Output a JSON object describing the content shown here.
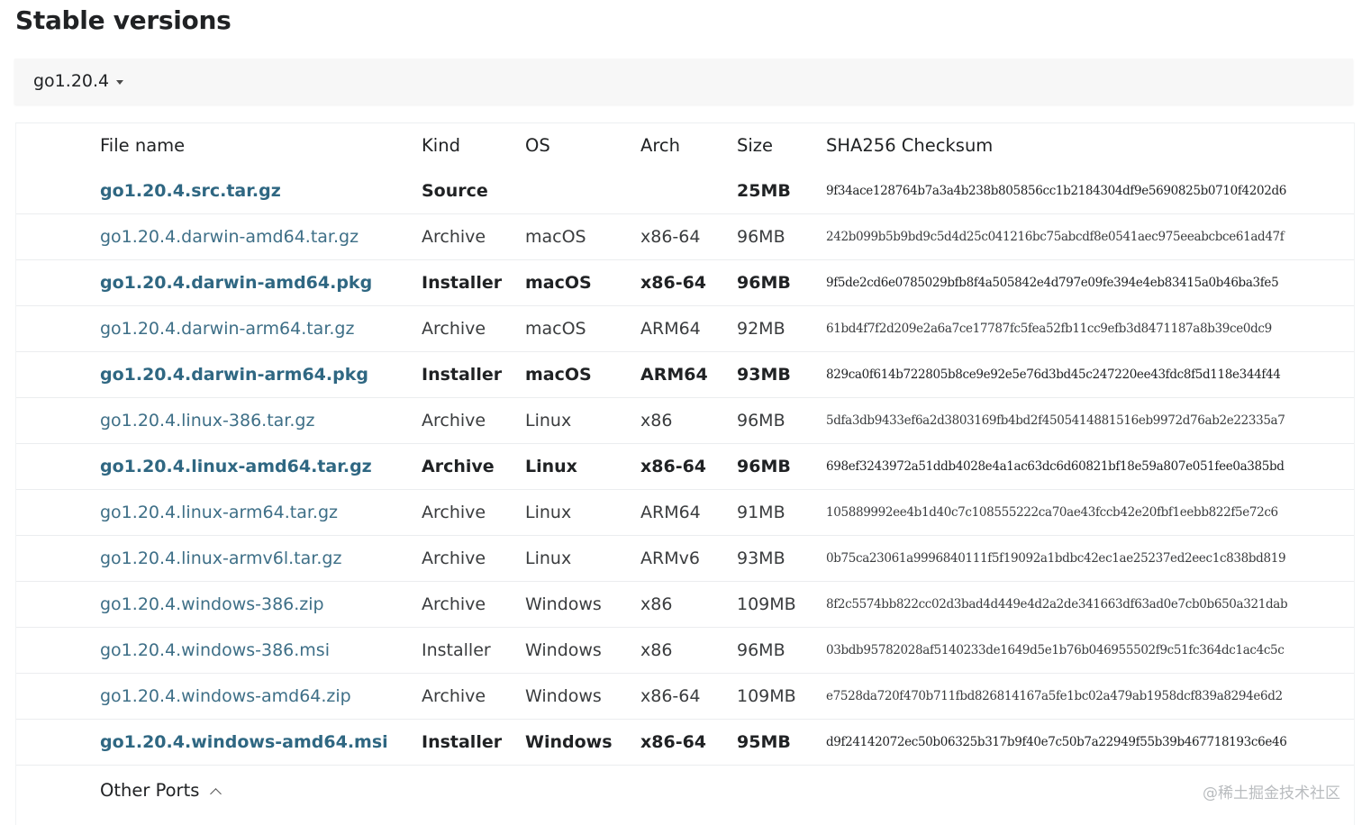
{
  "page": {
    "title": "Stable versions",
    "watermark": "@稀土掘金技术社区"
  },
  "version_selector": {
    "selected": "go1.20.4"
  },
  "table": {
    "columns": [
      "File name",
      "Kind",
      "OS",
      "Arch",
      "Size",
      "SHA256 Checksum"
    ],
    "rows": [
      {
        "file": "go1.20.4.src.tar.gz",
        "kind": "Source",
        "os": "",
        "arch": "",
        "size": "25MB",
        "sha": "9f34ace128764b7a3a4b238b805856cc1b2184304df9e5690825b0710f4202d6",
        "featured": true
      },
      {
        "file": "go1.20.4.darwin-amd64.tar.gz",
        "kind": "Archive",
        "os": "macOS",
        "arch": "x86-64",
        "size": "96MB",
        "sha": "242b099b5b9bd9c5d4d25c041216bc75abcdf8e0541aec975eeabcbce61ad47f",
        "featured": false
      },
      {
        "file": "go1.20.4.darwin-amd64.pkg",
        "kind": "Installer",
        "os": "macOS",
        "arch": "x86-64",
        "size": "96MB",
        "sha": "9f5de2cd6e0785029bfb8f4a505842e4d797e09fe394e4eb83415a0b46ba3fe5",
        "featured": true
      },
      {
        "file": "go1.20.4.darwin-arm64.tar.gz",
        "kind": "Archive",
        "os": "macOS",
        "arch": "ARM64",
        "size": "92MB",
        "sha": "61bd4f7f2d209e2a6a7ce17787fc5fea52fb11cc9efb3d8471187a8b39ce0dc9",
        "featured": false
      },
      {
        "file": "go1.20.4.darwin-arm64.pkg",
        "kind": "Installer",
        "os": "macOS",
        "arch": "ARM64",
        "size": "93MB",
        "sha": "829ca0f614b722805b8ce9e92e5e76d3bd45c247220ee43fdc8f5d118e344f44",
        "featured": true
      },
      {
        "file": "go1.20.4.linux-386.tar.gz",
        "kind": "Archive",
        "os": "Linux",
        "arch": "x86",
        "size": "96MB",
        "sha": "5dfa3db9433ef6a2d3803169fb4bd2f4505414881516eb9972d76ab2e22335a7",
        "featured": false
      },
      {
        "file": "go1.20.4.linux-amd64.tar.gz",
        "kind": "Archive",
        "os": "Linux",
        "arch": "x86-64",
        "size": "96MB",
        "sha": "698ef3243972a51ddb4028e4a1ac63dc6d60821bf18e59a807e051fee0a385bd",
        "featured": true
      },
      {
        "file": "go1.20.4.linux-arm64.tar.gz",
        "kind": "Archive",
        "os": "Linux",
        "arch": "ARM64",
        "size": "91MB",
        "sha": "105889992ee4b1d40c7c108555222ca70ae43fccb42e20fbf1eebb822f5e72c6",
        "featured": false
      },
      {
        "file": "go1.20.4.linux-armv6l.tar.gz",
        "kind": "Archive",
        "os": "Linux",
        "arch": "ARMv6",
        "size": "93MB",
        "sha": "0b75ca23061a9996840111f5f19092a1bdbc42ec1ae25237ed2eec1c838bd819",
        "featured": false
      },
      {
        "file": "go1.20.4.windows-386.zip",
        "kind": "Archive",
        "os": "Windows",
        "arch": "x86",
        "size": "109MB",
        "sha": "8f2c5574bb822cc02d3bad4d449e4d2a2de341663df63ad0e7cb0b650a321dab",
        "featured": false
      },
      {
        "file": "go1.20.4.windows-386.msi",
        "kind": "Installer",
        "os": "Windows",
        "arch": "x86",
        "size": "96MB",
        "sha": "03bdb95782028af5140233de1649d5e1b76b046955502f9c51fc364dc1ac4c5c",
        "featured": false
      },
      {
        "file": "go1.20.4.windows-amd64.zip",
        "kind": "Archive",
        "os": "Windows",
        "arch": "x86-64",
        "size": "109MB",
        "sha": "e7528da720f470b711fbd826814167a5fe1bc02a479ab1958dcf839a8294e6d2",
        "featured": false
      },
      {
        "file": "go1.20.4.windows-amd64.msi",
        "kind": "Installer",
        "os": "Windows",
        "arch": "x86-64",
        "size": "95MB",
        "sha": "d9f24142072ec50b06325b317b9f40e7c50b7a22949f55b39b467718193c6e46",
        "featured": true
      }
    ]
  },
  "other_ports": {
    "label": "Other Ports",
    "icon": "chevron-up-icon"
  }
}
